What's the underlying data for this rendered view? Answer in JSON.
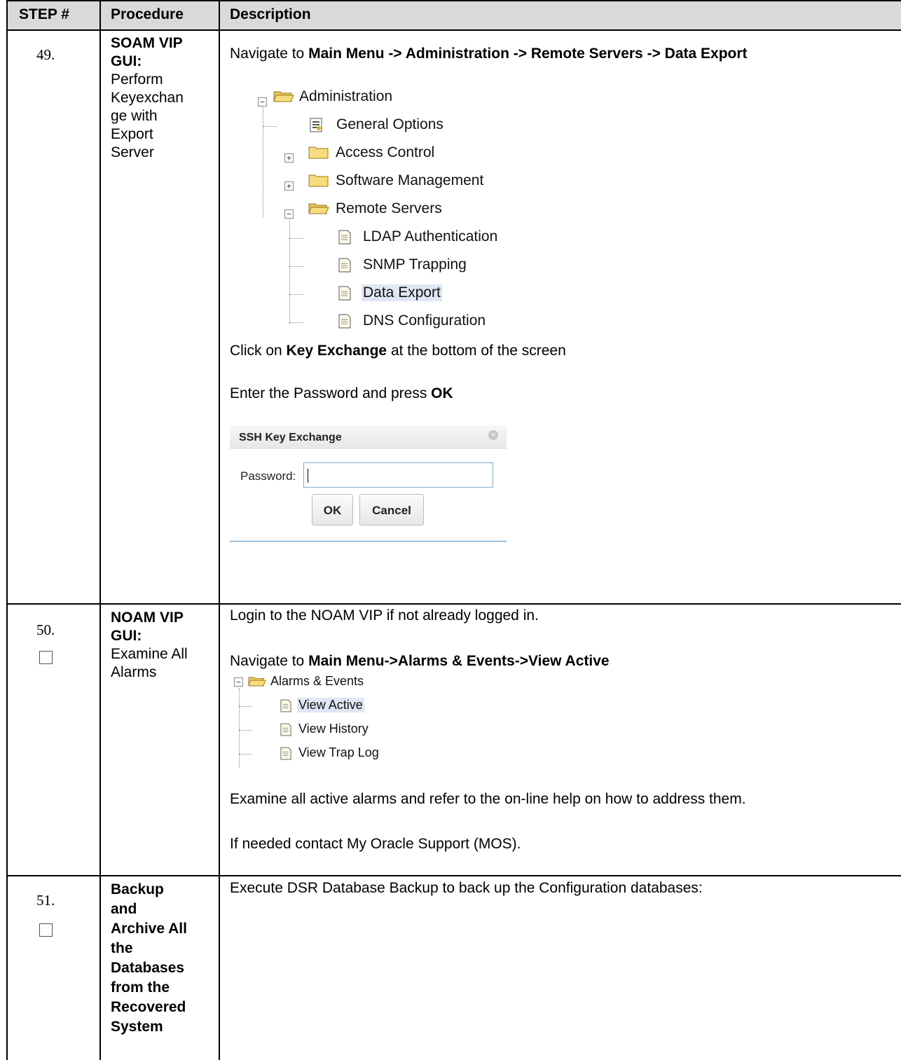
{
  "table": {
    "headers": {
      "step": "STEP #",
      "procedure": "Procedure",
      "description": "Description"
    }
  },
  "steps": [
    {
      "number": "49.",
      "procedure_bold": "SOAM VIP GUI:",
      "procedure_text": [
        "Perform",
        "Keyexchan",
        "ge with",
        "Export",
        "Server"
      ],
      "nav_prefix": "Navigate to ",
      "nav_bold": "Main Menu -> Administration -> Remote Servers -> Data Export",
      "tree": [
        {
          "label": "Administration",
          "icon": "folder-open-icon",
          "toggle": "minus"
        },
        {
          "label": "General Options",
          "icon": "options-page-icon"
        },
        {
          "label": "Access Control",
          "icon": "folder-icon",
          "toggle": "plus"
        },
        {
          "label": "Software Management",
          "icon": "folder-icon",
          "toggle": "plus"
        },
        {
          "label": "Remote Servers",
          "icon": "folder-open-icon",
          "toggle": "minus"
        },
        {
          "label": "LDAP Authentication",
          "icon": "page-icon"
        },
        {
          "label": "SNMP Trapping",
          "icon": "page-icon"
        },
        {
          "label": "Data Export",
          "icon": "page-icon",
          "selected": true
        },
        {
          "label": "DNS Configuration",
          "icon": "page-icon"
        }
      ],
      "click_prefix": "Click on ",
      "click_bold": "Key Exchange",
      "click_suffix": " at the bottom of the screen",
      "enter_prefix": "Enter the Password and press ",
      "enter_bold": "OK",
      "dialog": {
        "title": "SSH Key Exchange",
        "password_label": "Password:",
        "password_value": "",
        "ok_label": "OK",
        "cancel_label": "Cancel"
      }
    },
    {
      "number": "50.",
      "procedure_bold": "NOAM VIP GUI:",
      "procedure_text": [
        "Examine All",
        "Alarms"
      ],
      "login_text": "Login to the NOAM VIP if not already logged in.",
      "nav_prefix": "Navigate to ",
      "nav_bold": "Main Menu->Alarms & Events->View Active",
      "tree": [
        {
          "label": "Alarms & Events",
          "icon": "folder-open-icon",
          "toggle": "minus"
        },
        {
          "label": "View Active",
          "icon": "page-icon",
          "selected": true
        },
        {
          "label": "View History",
          "icon": "page-icon"
        },
        {
          "label": "View Trap Log",
          "icon": "page-icon"
        }
      ],
      "examine_text": "Examine all active alarms and refer to the on-line help on how to address them.",
      "contact_text": "If needed contact My Oracle Support (MOS)."
    },
    {
      "number": "51.",
      "procedure_bold_lines": [
        "Backup",
        "and",
        "Archive All",
        "the",
        "Databases",
        "from the",
        "Recovered",
        "System"
      ],
      "execute_text": "Execute DSR Database Backup to back up the Configuration databases:"
    }
  ],
  "colors": {
    "header_bg": "#d9d9d9",
    "selection_bg": "#dfe7f5",
    "dialog_rule": "#4a8ab8"
  }
}
